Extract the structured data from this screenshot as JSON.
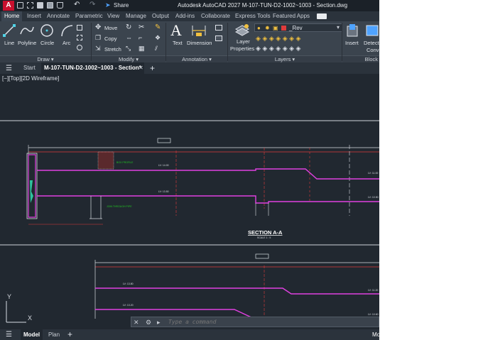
{
  "app": {
    "logo": "A",
    "title": "Autodesk AutoCAD 2027    M-107-TUN-D2-1002~1003 - Section.dwg",
    "share_label": "Share"
  },
  "ribbon_tabs": [
    "Home",
    "Insert",
    "Annotate",
    "Parametric",
    "View",
    "Manage",
    "Output",
    "Add-ins",
    "Collaborate",
    "Express Tools",
    "Featured Apps"
  ],
  "ribbon": {
    "draw": {
      "line": "Line",
      "polyline": "Polyline",
      "circle": "Circle",
      "arc": "Arc",
      "panel": "Draw ▾"
    },
    "modify": {
      "move": "Move",
      "copy": "Copy",
      "stretch": "Stretch",
      "panel": "Modify ▾"
    },
    "annotation": {
      "text": "Text",
      "dimension": "Dimension",
      "panel": "Annotation ▾"
    },
    "layers": {
      "properties_line1": "Layer",
      "properties_line2": "Properties",
      "current_layer": "_Rev",
      "panel": "Layers ▾"
    },
    "block": {
      "insert": "Insert",
      "detect_line1": "Detect",
      "detect_line2": "Conv",
      "panel": "Block"
    }
  },
  "doc_tabs": {
    "start": "Start",
    "active": "M-107-TUN-D2-1002~1003 - Section*"
  },
  "viewport": {
    "label": "[−][Top][2D Wireframe]"
  },
  "drawing": {
    "section_title": "SECTION A-A",
    "section_scale": "SCALE 1 : 5",
    "ucs_x": "X",
    "ucs_y": "Y"
  },
  "command_line": {
    "placeholder": "Type a command"
  },
  "status": {
    "model": "Model",
    "layout": "Plan",
    "right_cut": "Mo"
  },
  "colors": {
    "magenta": "#e040e0",
    "red": "#e03b3b",
    "green": "#21c421",
    "cyan": "#4fd2e6",
    "white": "#d8dde3",
    "canvas": "#212830"
  },
  "icons": [
    "app-logo-icon",
    "new-icon",
    "open-icon",
    "save-icon",
    "saveas-icon",
    "print-icon",
    "undo-icon",
    "redo-icon",
    "share-icon",
    "line-icon",
    "polyline-icon",
    "circle-icon",
    "arc-icon",
    "move-icon",
    "copy-icon",
    "stretch-icon",
    "rotate-icon",
    "trim-icon",
    "text-icon",
    "dimension-icon",
    "layer-properties-icon",
    "insert-icon",
    "menu-icon",
    "plus-icon",
    "close-icon",
    "ucs-icon"
  ]
}
